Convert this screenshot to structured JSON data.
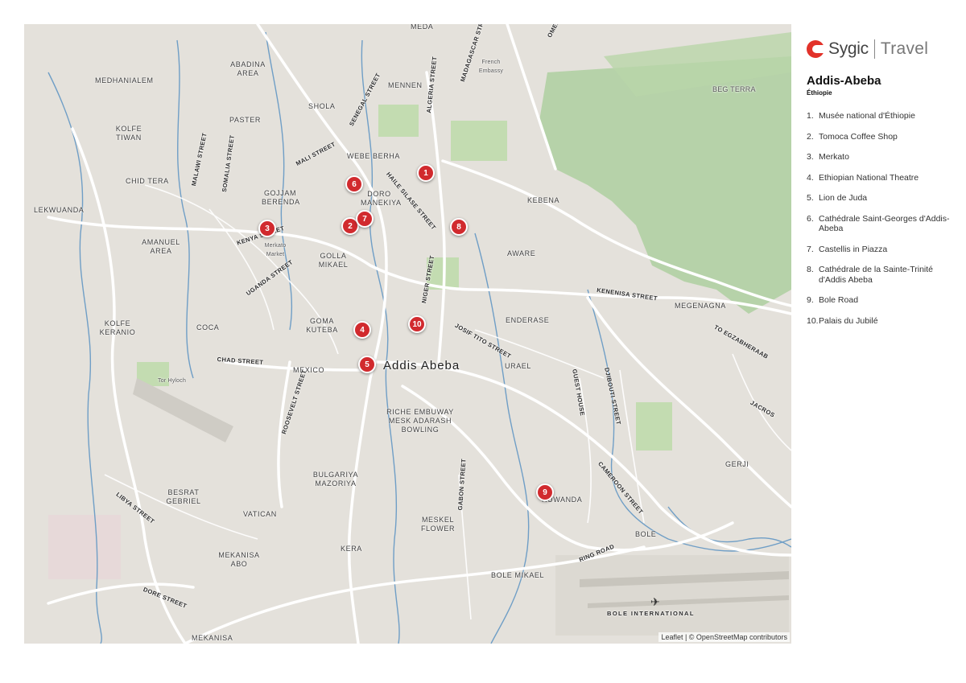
{
  "map": {
    "city_label": "Addis Abeba",
    "attribution": "Leaflet | © OpenStreetMap contributors",
    "colors": {
      "land": "#e4e1db",
      "park": "#c3dcb1",
      "hills": "#aecfa0",
      "river": "#6f9ec6",
      "road": "#ffffff",
      "marker": "#d12a2e"
    },
    "districts": [
      "MEDA",
      "ABADINA AREA",
      "MEDHANIALEM",
      "MENNEN",
      "SHOLA",
      "PASTER",
      "KOLFE TIWAN",
      "WEBE BERHA",
      "CHID TERA",
      "GOJJAM BERENDA",
      "DORO MANEKIYA",
      "LEKWUANDA",
      "KEBENA",
      "AMANUEL AREA",
      "GOLLA MIKAEL",
      "AWARE",
      "MEGENAGNA",
      "KOLFE KERANIO",
      "COCA",
      "GOMA KUTEBA",
      "ENDERASE",
      "MEXICO",
      "URAEL",
      "RICHE EMBUWAY MESK ADARASH BOWLING",
      "GERJI",
      "BULGARIYA MAZORIYA",
      "BESRAT GEBRIEL",
      "VATICAN",
      "RUWANDA",
      "MESKEL FLOWER",
      "BOLE",
      "KERA",
      "BOLE MIKAEL",
      "MEKANISA ABO",
      "MEKANISA",
      "BEG TERRA"
    ],
    "small_labels": [
      "French Embassy",
      "Merkato Market",
      "Tor Hyloch"
    ],
    "streets": [
      "SENEGAL STREET",
      "ALGERIA STREET",
      "MADAGASCAR STREET",
      "MALI STREET",
      "HAILE SILASE STREET",
      "MALAWI STREET",
      "SOMALIA STREET",
      "KENYA STREET",
      "UGANDA STREET",
      "NIGER STREET",
      "KENENISA STREET",
      "JOSIF TITO STREET",
      "CHAD STREET",
      "ROOSEVELT STREET",
      "GUEST HOUSE",
      "DJIBOUTI STREET",
      "TO EGZABHERAAB",
      "JACROS",
      "CAMEROON STREET",
      "GABON STREET",
      "LIBYA STREET",
      "RING ROAD",
      "DORE STREET",
      "BOLE INTERNATIONAL",
      "OMEDLA"
    ],
    "markers": [
      "1",
      "2",
      "3",
      "4",
      "5",
      "6",
      "7",
      "8",
      "9",
      "10"
    ]
  },
  "panel": {
    "brand": "Sygic",
    "brand2": "Travel",
    "title": "Addis-Abeba",
    "subtitle": "Éthiopie",
    "pois": [
      {
        "n": "1.",
        "name": "Musée national d'Éthiopie"
      },
      {
        "n": "2.",
        "name": "Tomoca Coffee Shop"
      },
      {
        "n": "3.",
        "name": "Merkato"
      },
      {
        "n": "4.",
        "name": "Ethiopian National Theatre"
      },
      {
        "n": "5.",
        "name": "Lion de Juda"
      },
      {
        "n": "6.",
        "name": "Cathédrale Saint-Georges d'Addis-Abeba"
      },
      {
        "n": "7.",
        "name": "Castellis in Piazza"
      },
      {
        "n": "8.",
        "name": "Cathédrale de la Sainte-Trinité d'Addis Abeba"
      },
      {
        "n": "9.",
        "name": "Bole Road"
      },
      {
        "n": "10.",
        "name": "Palais du Jubilé"
      }
    ]
  }
}
